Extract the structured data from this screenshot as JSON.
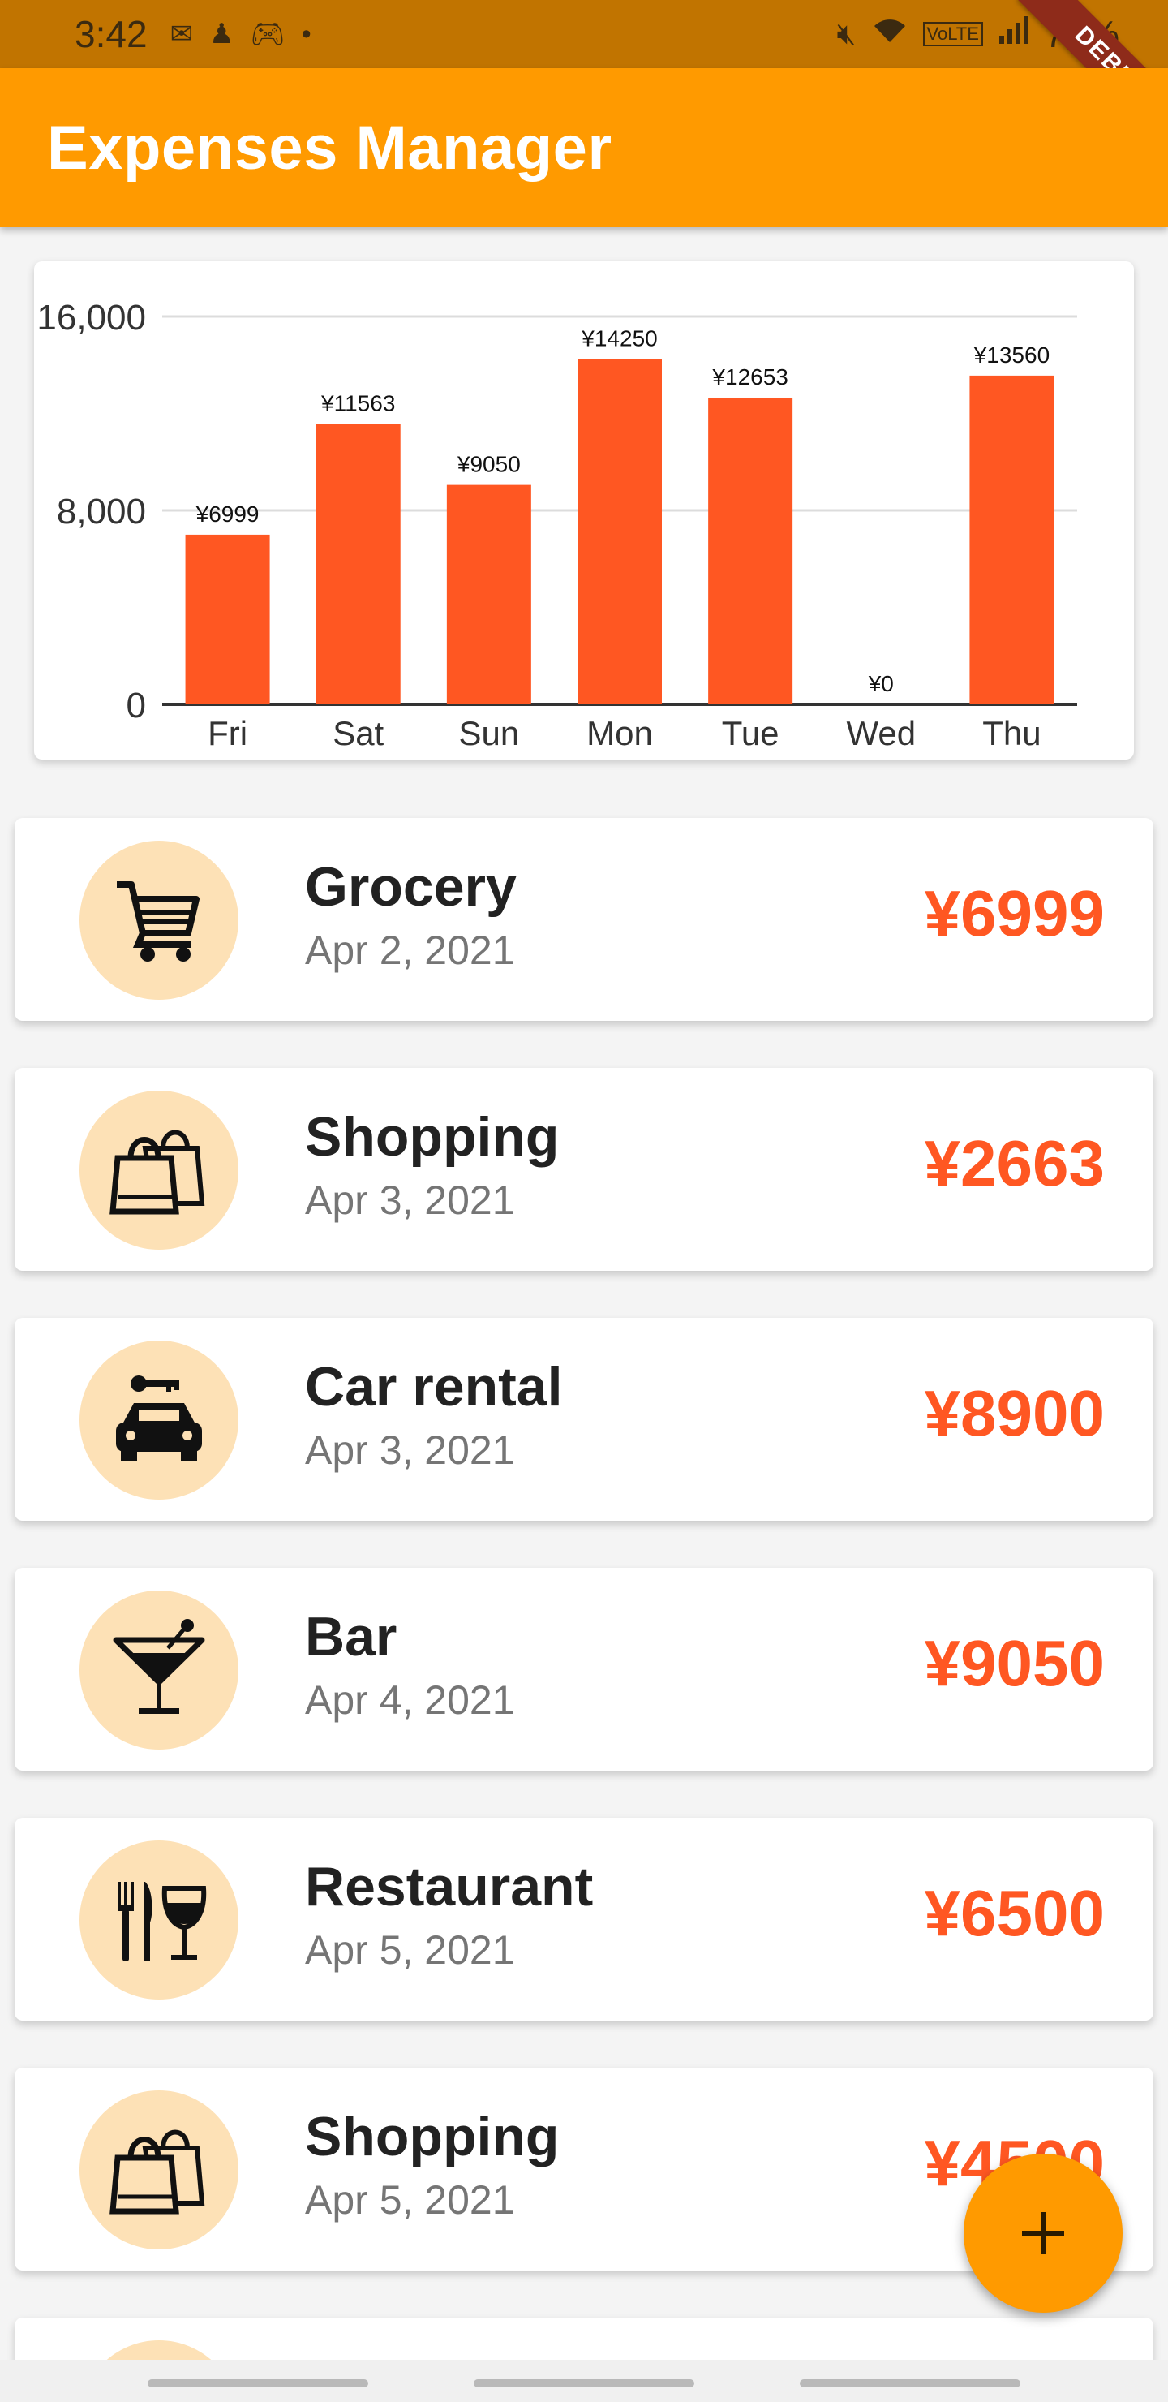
{
  "status_bar": {
    "time": "3:42",
    "battery": "70%"
  },
  "debug_ribbon": "DEBUG",
  "app_bar": {
    "title": "Expenses Manager"
  },
  "chart_data": {
    "type": "bar",
    "categories": [
      "Fri",
      "Sat",
      "Sun",
      "Mon",
      "Tue",
      "Wed",
      "Thu"
    ],
    "values": [
      6999,
      11563,
      9050,
      14250,
      12653,
      0,
      13560
    ],
    "data_labels": [
      "¥6999",
      "¥11563",
      "¥9050",
      "¥14250",
      "¥12653",
      "¥0",
      "¥13560"
    ],
    "y_ticks": [
      0,
      8000,
      16000
    ],
    "y_tick_labels": [
      "0",
      "8,000",
      "16,000"
    ],
    "ylim": [
      0,
      16000
    ],
    "grid": true,
    "bar_color": "#ff5722"
  },
  "expenses": [
    {
      "title": "Grocery",
      "date": "Apr 2, 2021",
      "amount": "¥6999",
      "icon": "cart-icon"
    },
    {
      "title": "Shopping",
      "date": "Apr 3, 2021",
      "amount": "¥2663",
      "icon": "shopping-bags-icon"
    },
    {
      "title": "Car rental",
      "date": "Apr 3, 2021",
      "amount": "¥8900",
      "icon": "car-key-icon"
    },
    {
      "title": "Bar",
      "date": "Apr 4, 2021",
      "amount": "¥9050",
      "icon": "cocktail-icon"
    },
    {
      "title": "Restaurant",
      "date": "Apr 5, 2021",
      "amount": "¥6500",
      "icon": "restaurant-icon"
    },
    {
      "title": "Shopping",
      "date": "Apr 5, 2021",
      "amount": "¥4500",
      "icon": "shopping-bags-icon"
    }
  ],
  "colors": {
    "primary": "#ff9a00",
    "status_bar": "#c17400",
    "accent": "#ff5722",
    "icon_bg": "#fde1b6"
  },
  "fab": {
    "icon": "plus-icon"
  }
}
